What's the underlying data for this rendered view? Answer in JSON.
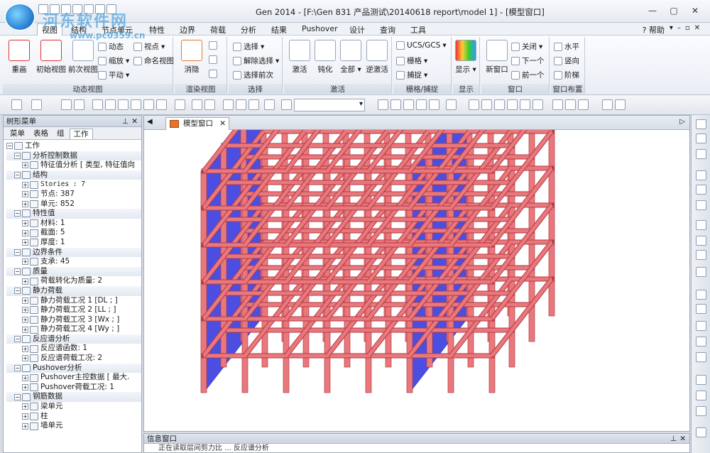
{
  "window": {
    "title": "Gen 2014 - [F:\\Gen 831 产品测试\\20140618 report\\model 1] - [模型窗口]",
    "watermark": "河东软件网",
    "watermark_url": "www.pc0359.cn"
  },
  "menubar": {
    "items": [
      "视图",
      "结构",
      "节点单元",
      "特性",
      "边界",
      "荷载",
      "分析",
      "结果",
      "Pushover",
      "设计",
      "查询",
      "工具"
    ],
    "help": "帮助"
  },
  "ribbon": {
    "dynamic_view": {
      "label": "动态视图",
      "buttons": [
        "重画",
        "初始视图",
        "前次视图"
      ],
      "small": [
        "动态",
        "缩放",
        "平动",
        "视点",
        "命名视图"
      ]
    },
    "render_view": {
      "label": "渲染视图",
      "buttons": [
        "消隐"
      ]
    },
    "select": {
      "label": "选择",
      "small": [
        "选择",
        "解除选择",
        "选择前次"
      ]
    },
    "activate": {
      "label": "激活",
      "buttons": [
        "激活",
        "钝化",
        "全部",
        "逆激活"
      ]
    },
    "grid_snap": {
      "label": "栅格/捕捉",
      "small": [
        "UCS/GCS",
        "栅格",
        "捕捉"
      ]
    },
    "display": {
      "label": "显示",
      "buttons": [
        "显示"
      ]
    },
    "window": {
      "label": "窗口",
      "buttons": [
        "新窗口"
      ],
      "small": [
        "关闭",
        "下一个",
        "前一个"
      ]
    },
    "window_layout": {
      "label": "窗口布置",
      "small": [
        "水平",
        "竖向",
        "阶梯"
      ]
    }
  },
  "left_panel": {
    "title": "树形菜单",
    "tabs": [
      "菜单",
      "表格",
      "组",
      "工作"
    ],
    "active_tab": "工作",
    "tree": [
      {
        "text": "工作",
        "level": 0,
        "section": false
      },
      {
        "text": "分析控制数据",
        "level": 1,
        "section": true
      },
      {
        "text": "特征值分析 [ 类型, 特征值向",
        "level": 2,
        "section": false
      },
      {
        "text": "结构",
        "level": 1,
        "section": true
      },
      {
        "text": "Stories : 7",
        "level": 2,
        "section": false,
        "mono": true
      },
      {
        "text": "节点: 387",
        "level": 2,
        "section": false
      },
      {
        "text": "单元: 852",
        "level": 2,
        "section": false
      },
      {
        "text": "特性值",
        "level": 1,
        "section": true
      },
      {
        "text": "材料: 1",
        "level": 2,
        "section": false
      },
      {
        "text": "截面: 5",
        "level": 2,
        "section": false
      },
      {
        "text": "厚度: 1",
        "level": 2,
        "section": false
      },
      {
        "text": "边界条件",
        "level": 1,
        "section": true
      },
      {
        "text": "支承: 45",
        "level": 2,
        "section": false
      },
      {
        "text": "质量",
        "level": 1,
        "section": true
      },
      {
        "text": "荷载转化为质量: 2",
        "level": 2,
        "section": false
      },
      {
        "text": "静力荷载",
        "level": 1,
        "section": true
      },
      {
        "text": "静力荷载工况 1 [DL ; ]",
        "level": 2,
        "section": false
      },
      {
        "text": "静力荷载工况 2 [LL ; ]",
        "level": 2,
        "section": false
      },
      {
        "text": "静力荷载工况 3 [Wx ; ]",
        "level": 2,
        "section": false
      },
      {
        "text": "静力荷载工况 4 [Wy ; ]",
        "level": 2,
        "section": false
      },
      {
        "text": "反应谱分析",
        "level": 1,
        "section": true
      },
      {
        "text": "反应谱函数: 1",
        "level": 2,
        "section": false
      },
      {
        "text": "反应谱荷载工况: 2",
        "level": 2,
        "section": false
      },
      {
        "text": "Pushover分析",
        "level": 1,
        "section": true
      },
      {
        "text": "Pushover主控数据 [ 最大.",
        "level": 2,
        "section": false
      },
      {
        "text": "Pushover荷载工况: 1",
        "level": 2,
        "section": false
      },
      {
        "text": "钢筋数据",
        "level": 1,
        "section": true
      },
      {
        "text": "梁单元",
        "level": 2,
        "section": false
      },
      {
        "text": "柱",
        "level": 2,
        "section": false
      },
      {
        "text": "墙单元",
        "level": 2,
        "section": false
      }
    ]
  },
  "document": {
    "tab_label": "模型窗口"
  },
  "info_window": {
    "title": "信息窗口",
    "line": "正在读取层间剪力比 ... 反应谱分析"
  },
  "colors": {
    "beam": "#e9787c",
    "beam_edge": "#b23a44",
    "wall": "#4b4ee0",
    "wall_dark": "#2d2fb4"
  }
}
